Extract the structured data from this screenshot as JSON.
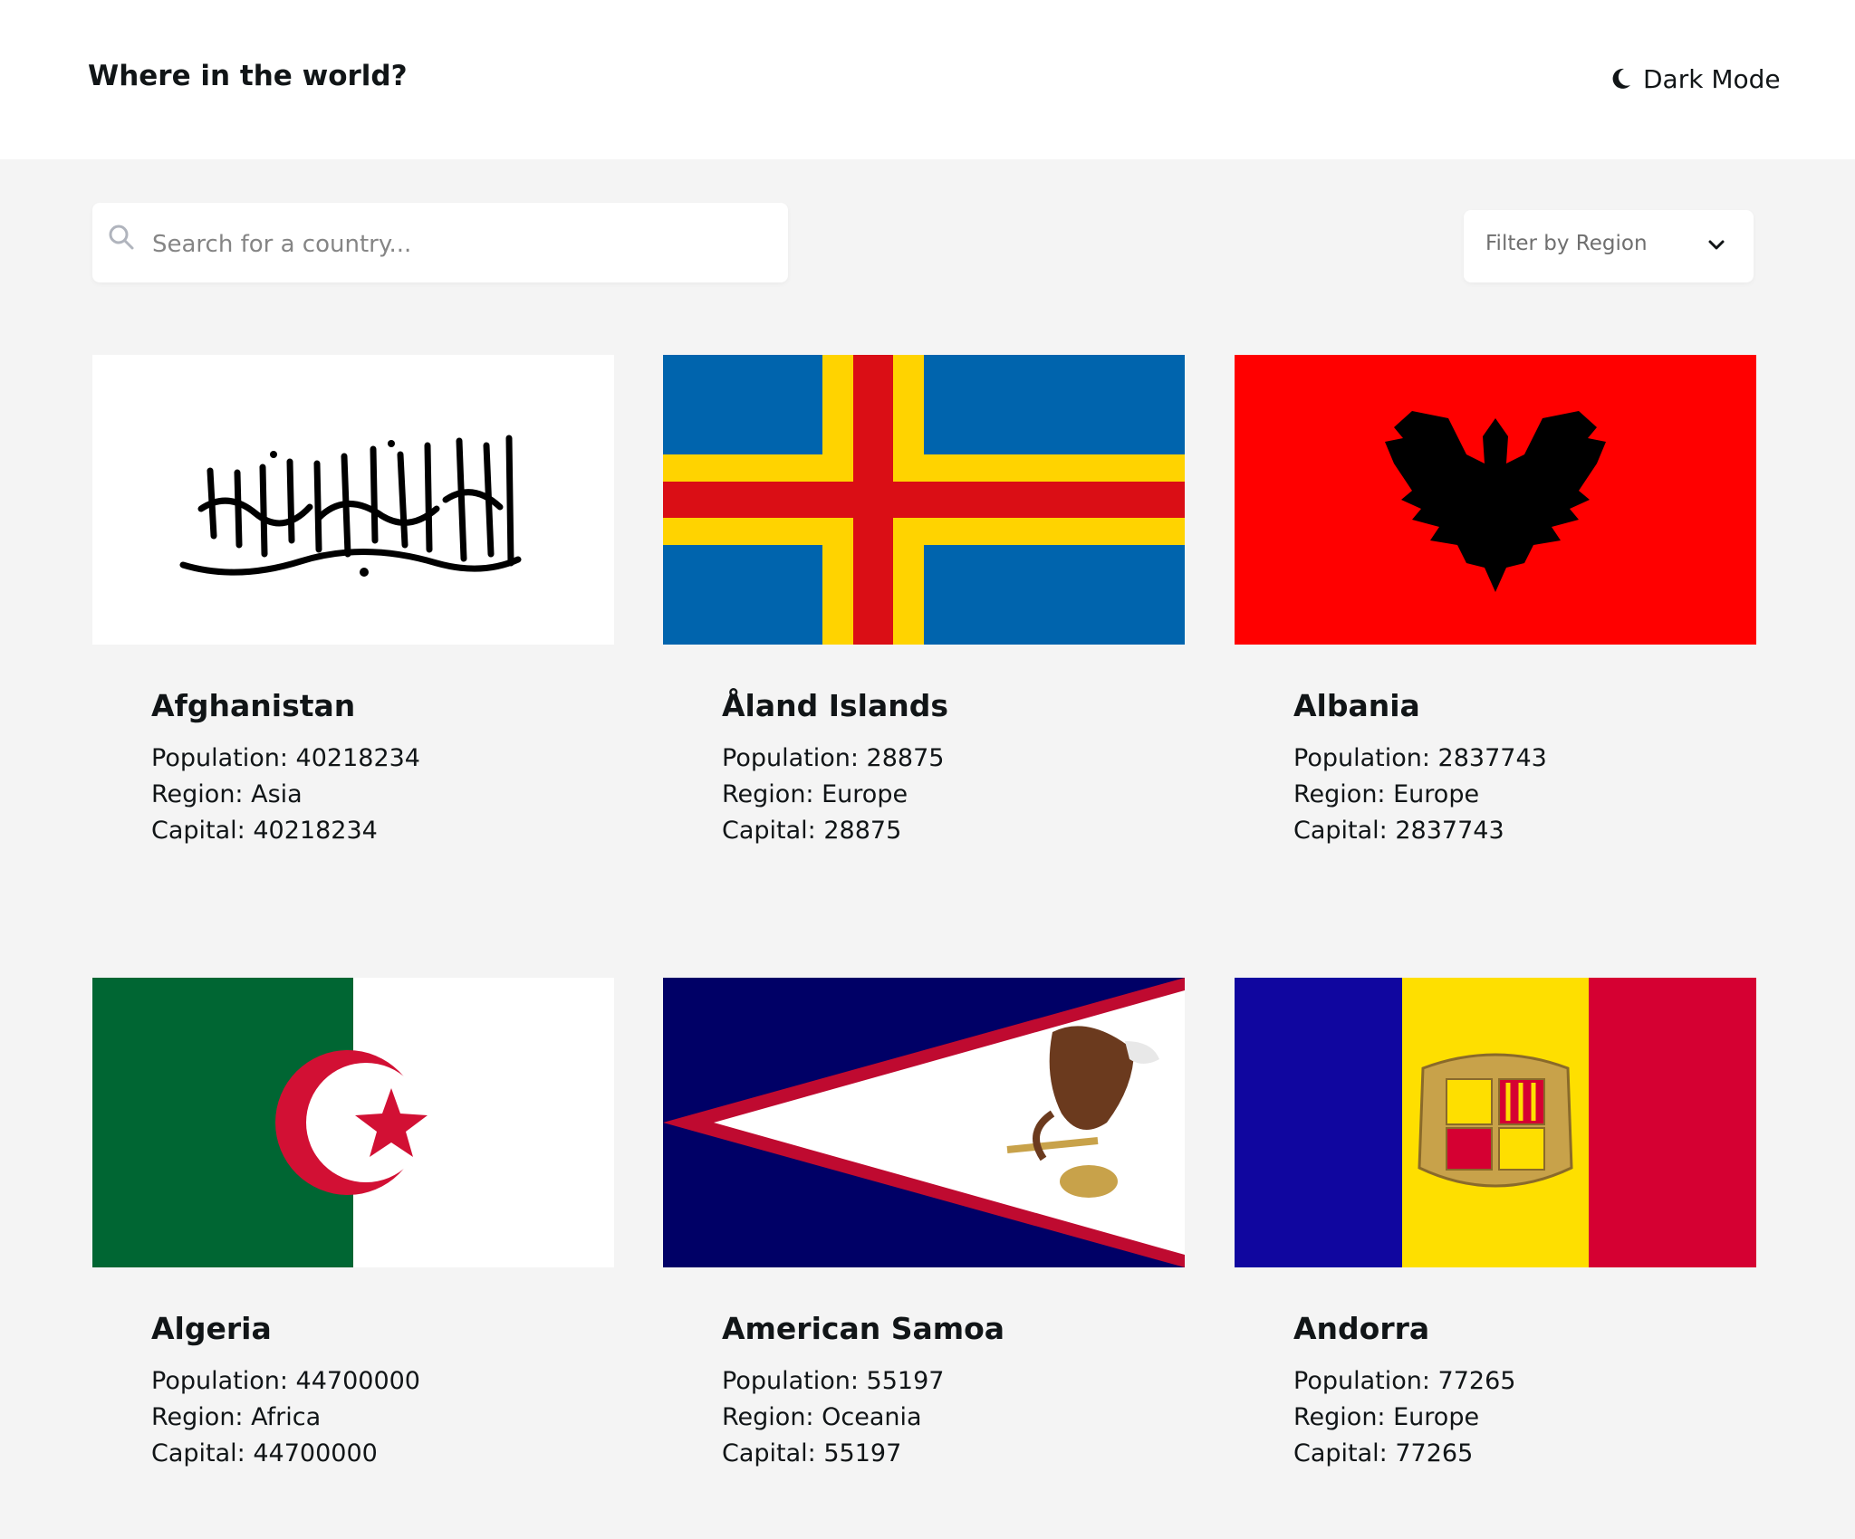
{
  "header": {
    "title": "Where in the world?",
    "theme_toggle_label": "Dark Mode",
    "theme_toggle_icon": "moon-icon"
  },
  "search": {
    "placeholder": "Search for a country...",
    "value": "",
    "icon": "search-icon"
  },
  "filter": {
    "label": "Filter by Region",
    "icon": "chevron-down-icon"
  },
  "field_labels": {
    "population": "Population:",
    "region": "Region:",
    "capital": "Capital:"
  },
  "countries": [
    {
      "name": "Afghanistan",
      "population": "40218234",
      "region": "Asia",
      "capital": "40218234"
    },
    {
      "name": "Åland Islands",
      "population": "28875",
      "region": "Europe",
      "capital": "28875"
    },
    {
      "name": "Albania",
      "population": "2837743",
      "region": "Europe",
      "capital": "2837743"
    },
    {
      "name": "Algeria",
      "population": "44700000",
      "region": "Africa",
      "capital": "44700000"
    },
    {
      "name": "American Samoa",
      "population": "55197",
      "region": "Oceania",
      "capital": "55197"
    },
    {
      "name": "Andorra",
      "population": "77265",
      "region": "Europe",
      "capital": "77265"
    }
  ],
  "flag_colors": {
    "afghanistan": {
      "bg": "#ffffff",
      "script": "#000000"
    },
    "aland": {
      "blue": "#0064ad",
      "yellow": "#ffd300",
      "red": "#da0e15"
    },
    "albania": {
      "red": "#ff0000",
      "eagle": "#000000"
    },
    "algeria": {
      "green": "#006633",
      "white": "#ffffff",
      "red": "#d21034"
    },
    "american_samoa": {
      "navy": "#000066",
      "red": "#bf0a30",
      "white": "#ffffff",
      "eagle": "#6b3a1e"
    },
    "andorra": {
      "blue": "#10069f",
      "yellow": "#fedf00",
      "red": "#d50032",
      "emblem": "#c8a24a"
    }
  }
}
